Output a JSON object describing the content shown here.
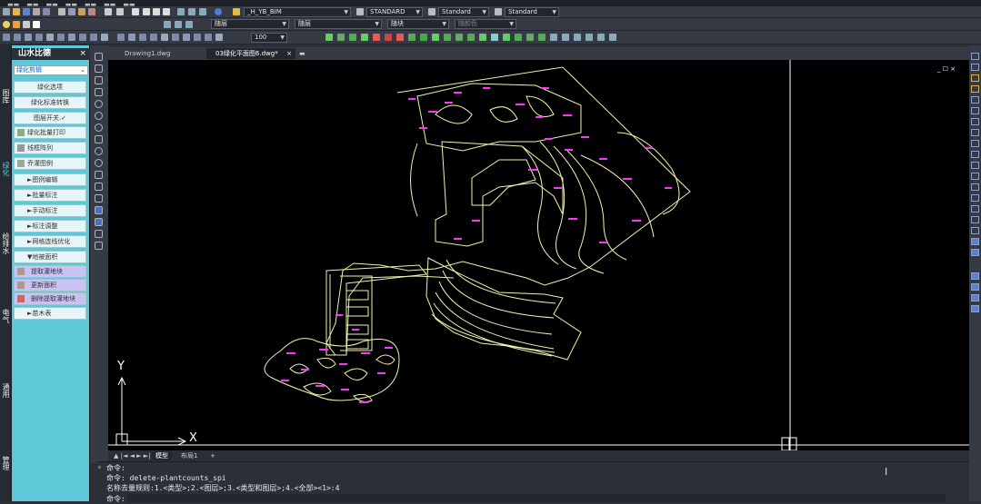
{
  "toolbar": {
    "layer_combo": "_H_YB_BIM",
    "textstyle_combo": "STANDARD",
    "dimstyle_combo": "Standard",
    "tablestyle_combo": "Standard",
    "color_combo": "随层",
    "linetype_combo": "随层",
    "lineweight_combo": "随块",
    "plotstyle_combo": "随颜色",
    "zoom_value": "100"
  },
  "left_strip": {
    "tabs": [
      "图库",
      "绿化",
      "给排水",
      "电气",
      "通用",
      "管理"
    ]
  },
  "panel": {
    "title": "山水比德",
    "close": "×",
    "dropdown_value": "绿化剪辑",
    "items": [
      {
        "label": "绿化选项",
        "type": "btn"
      },
      {
        "label": "绿化标准转换",
        "type": "btn"
      },
      {
        "label": "图层开关.✓",
        "type": "btn"
      },
      {
        "label": "绿化批量打印",
        "type": "icon"
      },
      {
        "label": "线框阵列",
        "type": "icon"
      },
      {
        "label": "乔灌图例",
        "type": "icon"
      },
      {
        "label": "►图例编辑",
        "type": "sub"
      },
      {
        "label": "►批量标注",
        "type": "sub"
      },
      {
        "label": "►手动标注",
        "type": "sub"
      },
      {
        "label": "►标注调整",
        "type": "sub"
      },
      {
        "label": "►网格连线优化",
        "type": "sub"
      },
      {
        "label": "▼地被面积",
        "type": "sub"
      },
      {
        "label": "提取灌地块",
        "type": "hl"
      },
      {
        "label": "更新面积",
        "type": "hl"
      },
      {
        "label": "删除提取灌地块",
        "type": "hl"
      },
      {
        "label": "►苗木表",
        "type": "sub"
      }
    ]
  },
  "doc_tabs": [
    {
      "label": "Drawing1.dwg",
      "active": false
    },
    {
      "label": "03绿化平面图6.dwg*",
      "active": true
    }
  ],
  "viewport": {
    "axis_y": "Y",
    "axis_x": "X",
    "window_controls": "_ ☐ ×"
  },
  "layout_tabs": [
    {
      "label": "模型",
      "active": true
    },
    {
      "label": "布局1",
      "active": false
    },
    {
      "label": "+",
      "active": false
    }
  ],
  "command": {
    "line1": "命令:",
    "line2": "命令: delete-plantcounts_spi",
    "line3": "名称去量规则:1.<类型>;2.<图层>;3.<类型和图层>;4.<全部><1>:4",
    "prompt": "命令:",
    "input_value": ""
  },
  "colors": {
    "accent_cyan": "#5ec8d8",
    "plan_lines": "#f2f2b0",
    "plant_labels": "#ff33ff"
  }
}
